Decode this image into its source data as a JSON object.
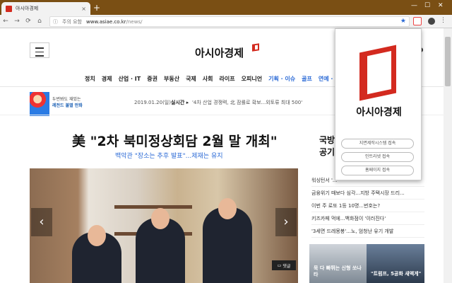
{
  "browser": {
    "tab_title": "아시아경제",
    "tab_close": "×",
    "new_tab": "+",
    "window_controls": [
      "—",
      "☐",
      "✕"
    ],
    "security_label": "주의 요함",
    "url_host": "www.asiae.co.kr",
    "url_path": "/news/",
    "nav_icons": [
      "←",
      "→",
      "⟳",
      "⌂",
      "ⓘ"
    ],
    "star_icon": "★",
    "menu_icon": "⋮"
  },
  "site": {
    "logo_text": "아시아경제",
    "nav": [
      "정치",
      "경제",
      "산업 · IT",
      "증권",
      "부동산",
      "국제",
      "사회",
      "라이프",
      "오피니언",
      "기획 · 이슈",
      "골프",
      "연예 · 스포츠"
    ],
    "promo": {
      "line1": "두번봐도 재밌는",
      "line2": "레전드 불멸 만화"
    },
    "date": "2019.01.20(일)",
    "trend_label": "실시간 ▸",
    "trend_text": "'4차 산업 경쟁력, 北 잠룔로 확보...외토류 최대 500'"
  },
  "article": {
    "headline": "美 \"2차 북미정상회담 2월 말 개최\"",
    "subhead": "백악관 \"장소는 추후 발표\"...제재는 유지",
    "comment_label": "댓글",
    "prev": "‹",
    "next": "›"
  },
  "sidebar": {
    "title_line1": "국방",
    "title_line2": "공기",
    "items": [
      "워싱턴서 '...",
      "금융위기 때보다 심각...지방 주택시장 드리...",
      "이번 주 로또 1등 10명...번호는?",
      "키즈카페 먹에...백화점이 '이러진다'",
      "'3세면 드레몽봉'...노, 엄청난 유기 개발"
    ],
    "thumb1_caption": "묵 다 빠뛰는 신형 쏘나타",
    "thumb2_caption": "\"트럼프, 5공화 새엑게\""
  },
  "popup": {
    "name": "아시아경제",
    "buttons": [
      "지면제작시스템 접속",
      "인트라넷 접속",
      "홈페이지 접속"
    ]
  },
  "colors": {
    "brand": "#d32a1f",
    "link": "#2b6ad6",
    "frame": "#7a4f14"
  }
}
